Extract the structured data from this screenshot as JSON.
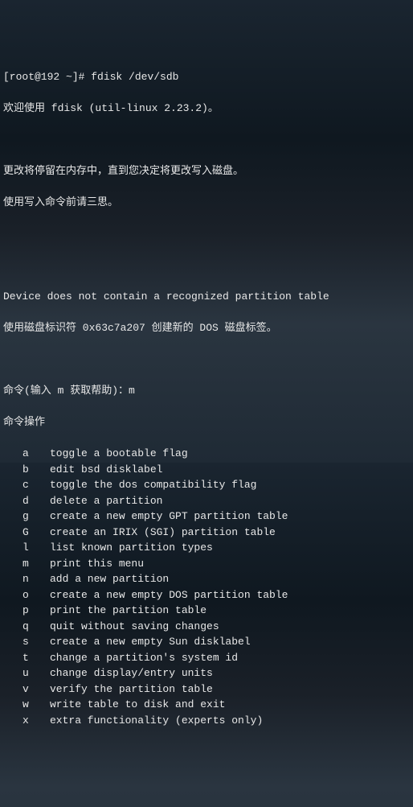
{
  "prompt": "[root@192 ~]# ",
  "command": "fdisk /dev/sdb",
  "welcome": "欢迎使用 fdisk (util-linux 2.23.2)。",
  "notice1": "更改将停留在内存中，直到您决定将更改写入磁盘。",
  "notice2": "使用写入命令前请三思。",
  "device_msg": "Device does not contain a recognized partition table",
  "disk_id_msg": "使用磁盘标识符 0x63c7a207 创建新的 DOS 磁盘标签。",
  "help_prompt": "命令(输入 m 获取帮助)：",
  "help_input": "m",
  "help_header": "命令操作",
  "commands": [
    {
      "key": "a",
      "desc": "toggle a bootable flag"
    },
    {
      "key": "b",
      "desc": "edit bsd disklabel"
    },
    {
      "key": "c",
      "desc": "toggle the dos compatibility flag"
    },
    {
      "key": "d",
      "desc": "delete a partition"
    },
    {
      "key": "g",
      "desc": "create a new empty GPT partition table"
    },
    {
      "key": "G",
      "desc": "create an IRIX (SGI) partition table"
    },
    {
      "key": "l",
      "desc": "list known partition types"
    },
    {
      "key": "m",
      "desc": "print this menu"
    },
    {
      "key": "n",
      "desc": "add a new partition"
    },
    {
      "key": "o",
      "desc": "create a new empty DOS partition table"
    },
    {
      "key": "p",
      "desc": "print the partition table"
    },
    {
      "key": "q",
      "desc": "quit without saving changes"
    },
    {
      "key": "s",
      "desc": "create a new empty Sun disklabel"
    },
    {
      "key": "t",
      "desc": "change a partition's system id"
    },
    {
      "key": "u",
      "desc": "change display/entry units"
    },
    {
      "key": "v",
      "desc": "verify the partition table"
    },
    {
      "key": "w",
      "desc": "write table to disk and exit"
    },
    {
      "key": "x",
      "desc": "extra functionality (experts only)"
    }
  ]
}
